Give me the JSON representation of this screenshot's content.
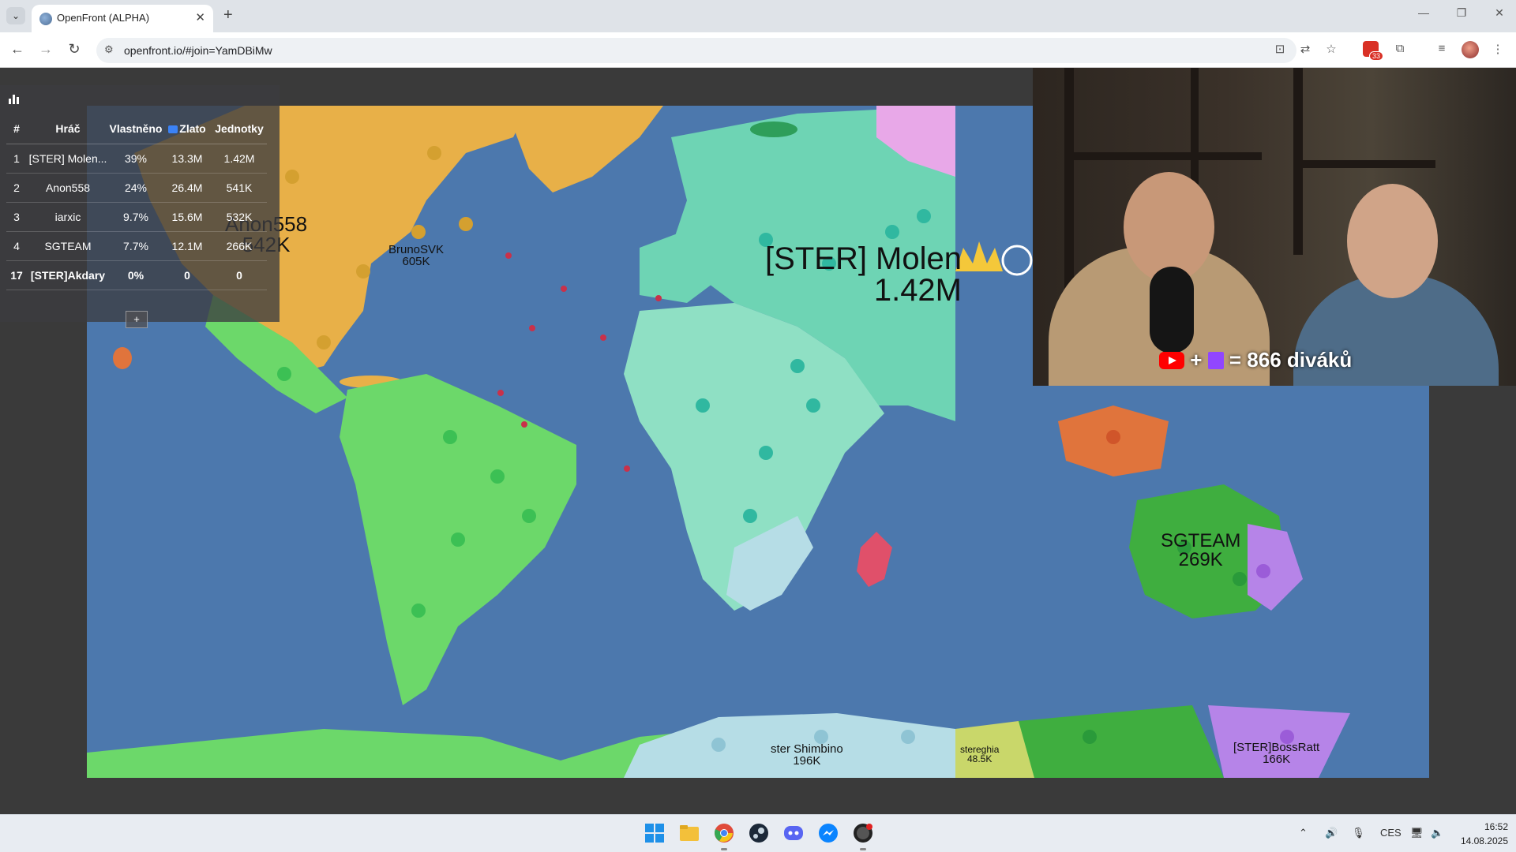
{
  "browser": {
    "tab_title": "OpenFront (ALPHA)",
    "tab_close": "✕",
    "new_tab": "+",
    "url": "openfront.io/#join=YamDBiMw",
    "ext_badge": "33"
  },
  "leaderboard": {
    "headers": [
      "#",
      "Hráč",
      "Vlastněno",
      "Zlato",
      "Jednotky"
    ],
    "rows": [
      {
        "rank": "1",
        "player": "[STER] Molen...",
        "owned": "39%",
        "gold": "13.3M",
        "troops": "1.42M"
      },
      {
        "rank": "2",
        "player": "Anon558",
        "owned": "24%",
        "gold": "26.4M",
        "troops": "541K"
      },
      {
        "rank": "3",
        "player": "iarxic",
        "owned": "9.7%",
        "gold": "15.6M",
        "troops": "532K"
      },
      {
        "rank": "4",
        "player": "SGTEAM",
        "owned": "7.7%",
        "gold": "12.1M",
        "troops": "266K"
      },
      {
        "rank": "17",
        "player": "[STER]Akdary",
        "owned": "0%",
        "gold": "0",
        "troops": "0"
      }
    ],
    "expand_label": "+"
  },
  "map_labels": {
    "anon_name": "Anon558",
    "anon_troops": "542K",
    "bruno_name": "BrunoSVK",
    "bruno_troops": "605K",
    "ster_name": "[STER] Molen",
    "ster_troops": "1.42M",
    "sgteam_name": "SGTEAM",
    "sgteam_troops": "269K",
    "shimbino_name": "ster Shimbino",
    "shimbino_troops": "196K",
    "stereghia_name": "stereghia",
    "stereghia_troops": "48.5K",
    "bossratt_name": "[STER]BossRatt",
    "bossratt_troops": "166K"
  },
  "overlay": {
    "plus": "+",
    "viewers_text": "= 866 diváků"
  },
  "taskbar": {
    "language": "CES",
    "time": "16:52",
    "date": "14.08.2025"
  },
  "colors": {
    "ocean": "#4c78ad",
    "anon558": "#e8b048",
    "ster_molen": "#6ed4b4",
    "green_player": "#6cd86a",
    "sgteam": "#3fae3f",
    "purple_player": "#b684e8",
    "orange_player": "#e0743c",
    "light_blue_player": "#b6dde6"
  }
}
